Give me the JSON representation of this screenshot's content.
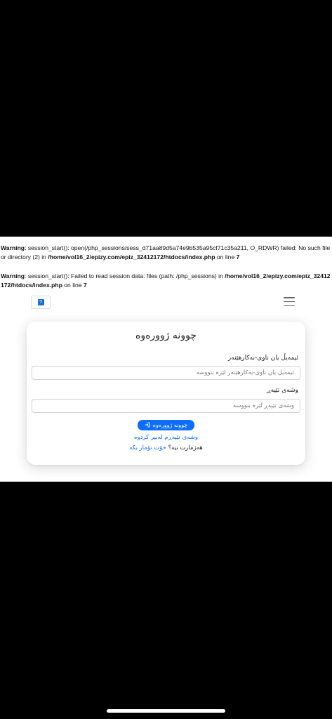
{
  "warnings": [
    {
      "label": "Warning",
      "message": ": session_start(): open(/php_sessions/sess_d71aa89d5a74e9b535a95cf71c35a211, O_RDWR) failed: No such file or directory (2) in ",
      "path": "/home/vol16_2/epizy.com/epiz_32412172/htdocs/index.php",
      "on_line": " on line ",
      "line": "7"
    },
    {
      "label": "Warning",
      "message": ": session_start(): Failed to read session data: files (path: /php_sessions) in ",
      "path": "/home/vol16_2/epizy.com/epiz_32412172/htdocs/index.php",
      "on_line": " on line ",
      "line": "7"
    }
  ],
  "navbar": {
    "brand_glyph": "?",
    "toggler_icon": "hamburger-menu-icon"
  },
  "login": {
    "title": "چوونە ژوورەوە",
    "username_label": "ئیمەیڵ یان ناوی-بەکارهێنەر",
    "username_placeholder": "ئیمەیڵ یان ناوی-بەکارهێنەر لێرە بنووسە",
    "password_label": "وشەی تێپەڕ",
    "password_placeholder": "وشەی تێپەڕ لێرە بنووسە",
    "submit_label": "چوونە ژوورەوە",
    "submit_icon": "sign-in-icon",
    "forgot_link": "وشەی تێپەڕم لەبیر کردوە",
    "no_account_text": "هەژمارت نیە؟",
    "register_link": "خۆت تۆمار بکە"
  },
  "colors": {
    "primary": "#0d6efd",
    "background": "#000000",
    "page": "#ffffff"
  }
}
